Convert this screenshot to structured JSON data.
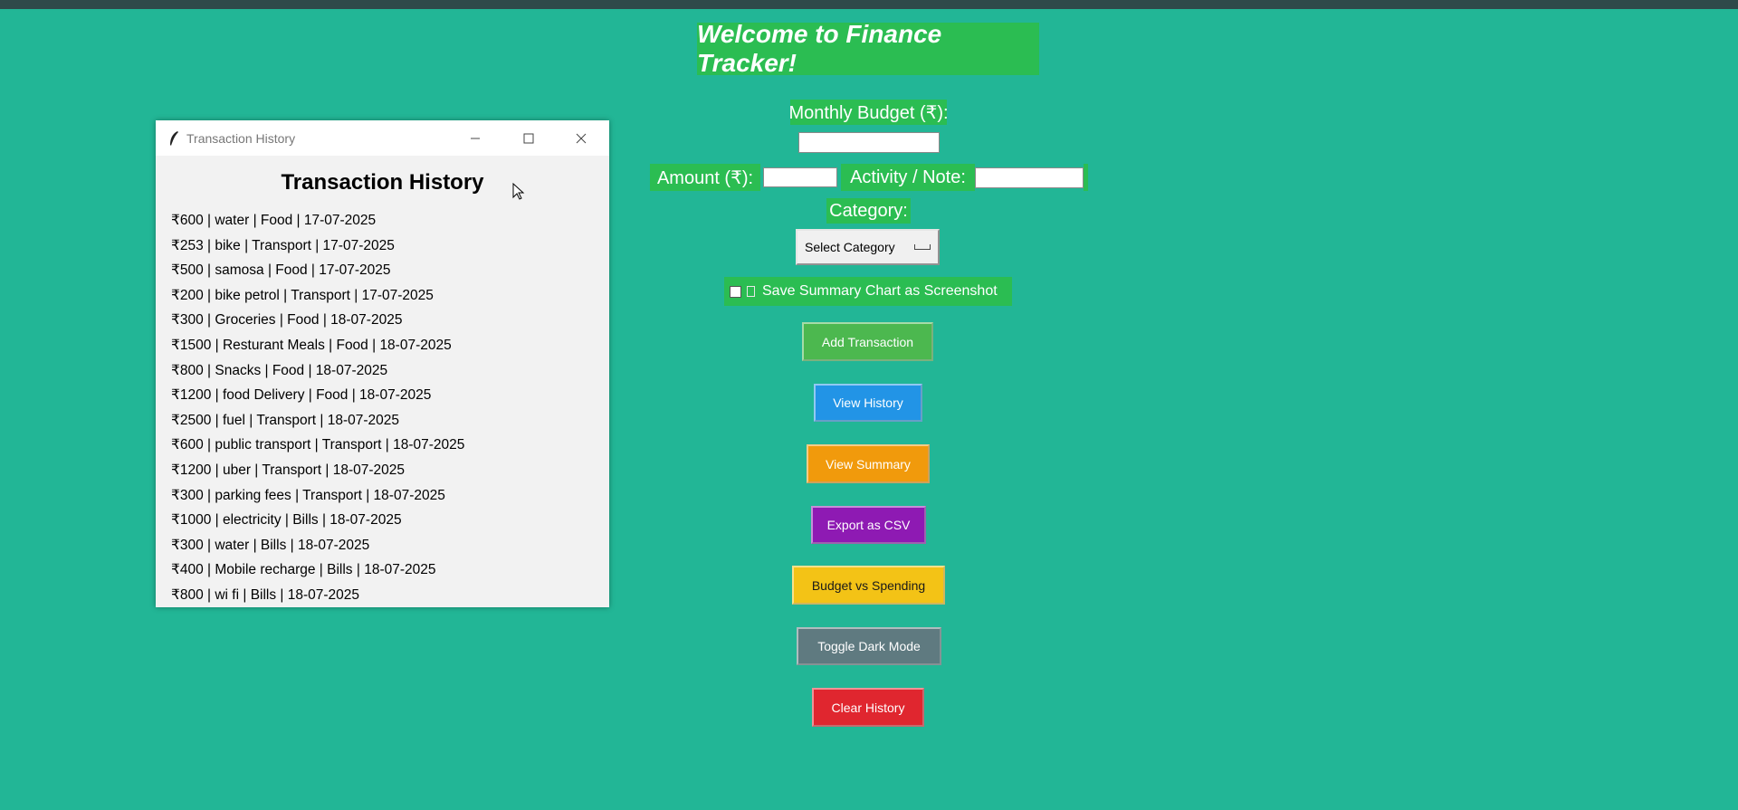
{
  "app": {
    "heading": "Welcome to Finance Tracker!"
  },
  "form": {
    "budget_label": "Monthly Budget (₹):",
    "budget_value": "",
    "amount_label": "Amount (₹):",
    "amount_value": "",
    "note_label": "Activity / Note:",
    "note_value": "",
    "category_label": "Category:",
    "category_selected": "Select Category",
    "save_chart_label": "Save Summary Chart as Screenshot"
  },
  "buttons": [
    {
      "id": "add-transaction-button",
      "label": "Add Transaction",
      "color": "#4cb84f"
    },
    {
      "id": "view-history-button",
      "label": "View History",
      "color": "#2294e6"
    },
    {
      "id": "view-summary-button",
      "label": "View Summary",
      "color": "#f19a0c"
    },
    {
      "id": "export-csv-button",
      "label": "Export as CSV",
      "color": "#8e1ab3"
    },
    {
      "id": "budget-vs-spending-button",
      "label": "Budget vs Spending",
      "color": "#f3c316"
    },
    {
      "id": "toggle-dark-mode-button",
      "label": "Toggle Dark Mode",
      "color": "#5f7a80"
    },
    {
      "id": "clear-history-button",
      "label": "Clear History",
      "color": "#e0262f"
    }
  ],
  "history_window": {
    "window_title": "Transaction History",
    "heading": "Transaction History",
    "items": [
      "₹600 | water | Food | 17-07-2025",
      "₹253 | bike | Transport | 17-07-2025",
      "₹500 | samosa | Food | 17-07-2025",
      "₹200 | bike petrol | Transport | 17-07-2025",
      "₹300 | Groceries | Food | 18-07-2025",
      "₹1500 | Resturant Meals | Food | 18-07-2025",
      "₹800 | Snacks | Food | 18-07-2025",
      "₹1200 | food Delivery | Food | 18-07-2025",
      "₹2500 | fuel | Transport | 18-07-2025",
      "₹600 | public transport | Transport | 18-07-2025",
      "₹1200 | uber | Transport | 18-07-2025",
      "₹300 | parking fees | Transport | 18-07-2025",
      "₹1000 | electricity | Bills | 18-07-2025",
      "₹300 | water | Bills | 18-07-2025",
      "₹400 | Mobile recharge | Bills | 18-07-2025",
      "₹800 | wi fi | Bills | 18-07-2025"
    ]
  },
  "colors": {
    "background": "#22b696",
    "label_bg": "#2bbd52"
  }
}
